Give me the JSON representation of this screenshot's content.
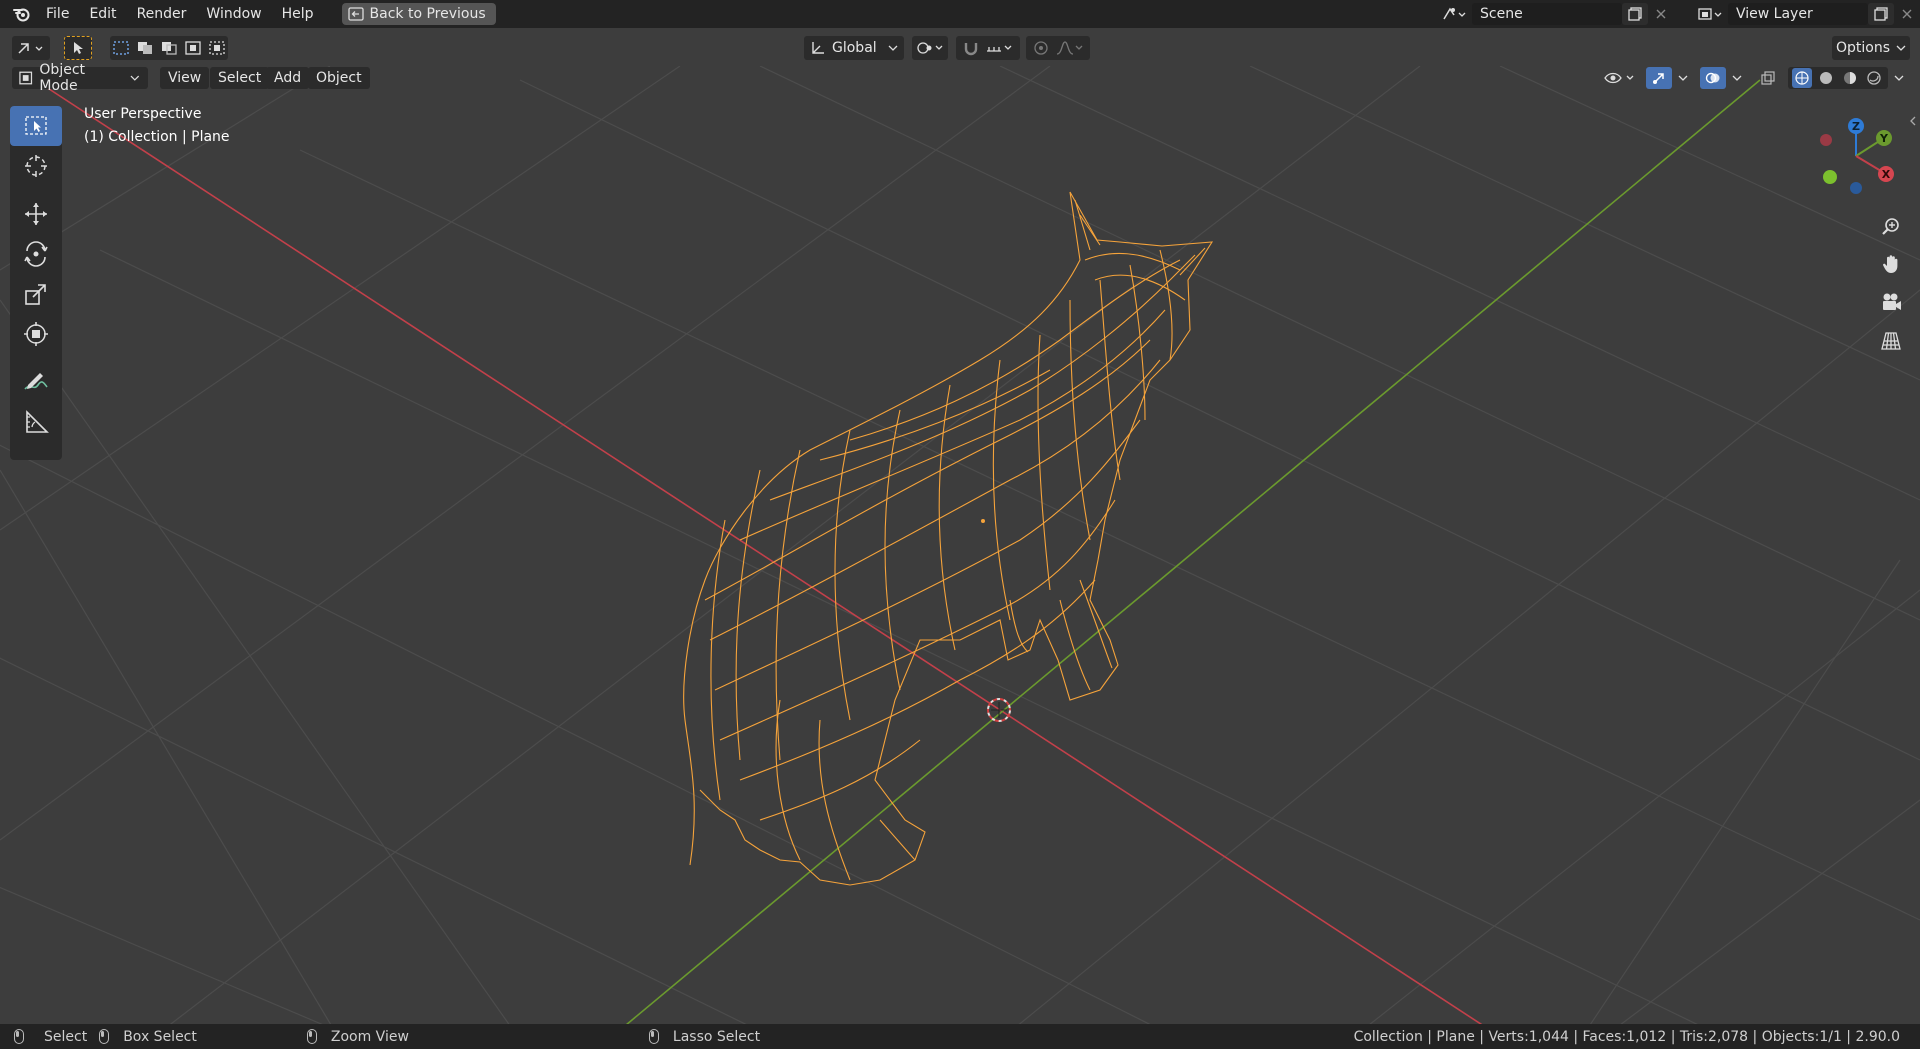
{
  "topbar": {
    "menu": [
      "File",
      "Edit",
      "Render",
      "Window",
      "Help"
    ],
    "back_button": "Back to Previous",
    "scene_name": "Scene",
    "view_layer": "View Layer"
  },
  "header": {
    "transform_orientation": "Global",
    "options_label": "Options"
  },
  "viewport_header": {
    "mode": "Object Mode",
    "menus": [
      "View",
      "Select",
      "Add",
      "Object"
    ]
  },
  "viewport": {
    "perspective": "User Perspective",
    "collection_info": "(1) Collection | Plane",
    "gizmo_axes": {
      "x": "X",
      "y": "Y",
      "z": "Z"
    }
  },
  "toolbar": {
    "tools": [
      "select-box",
      "cursor",
      "move",
      "rotate",
      "scale",
      "transform",
      "annotate",
      "measure"
    ]
  },
  "statusbar": {
    "select": "Select",
    "box_select": "Box Select",
    "zoom_view": "Zoom View",
    "lasso_select": "Lasso Select",
    "stats": "Collection | Plane | Verts:1,044 | Faces:1,012 | Tris:2,078 | Objects:1/1 | 2.90.0"
  },
  "colors": {
    "accent": "#4772b3",
    "selection_wire": "#f5a33b",
    "x_axis": "#c2404a",
    "y_axis": "#6b9a2e",
    "z_axis": "#2e7bd6"
  }
}
